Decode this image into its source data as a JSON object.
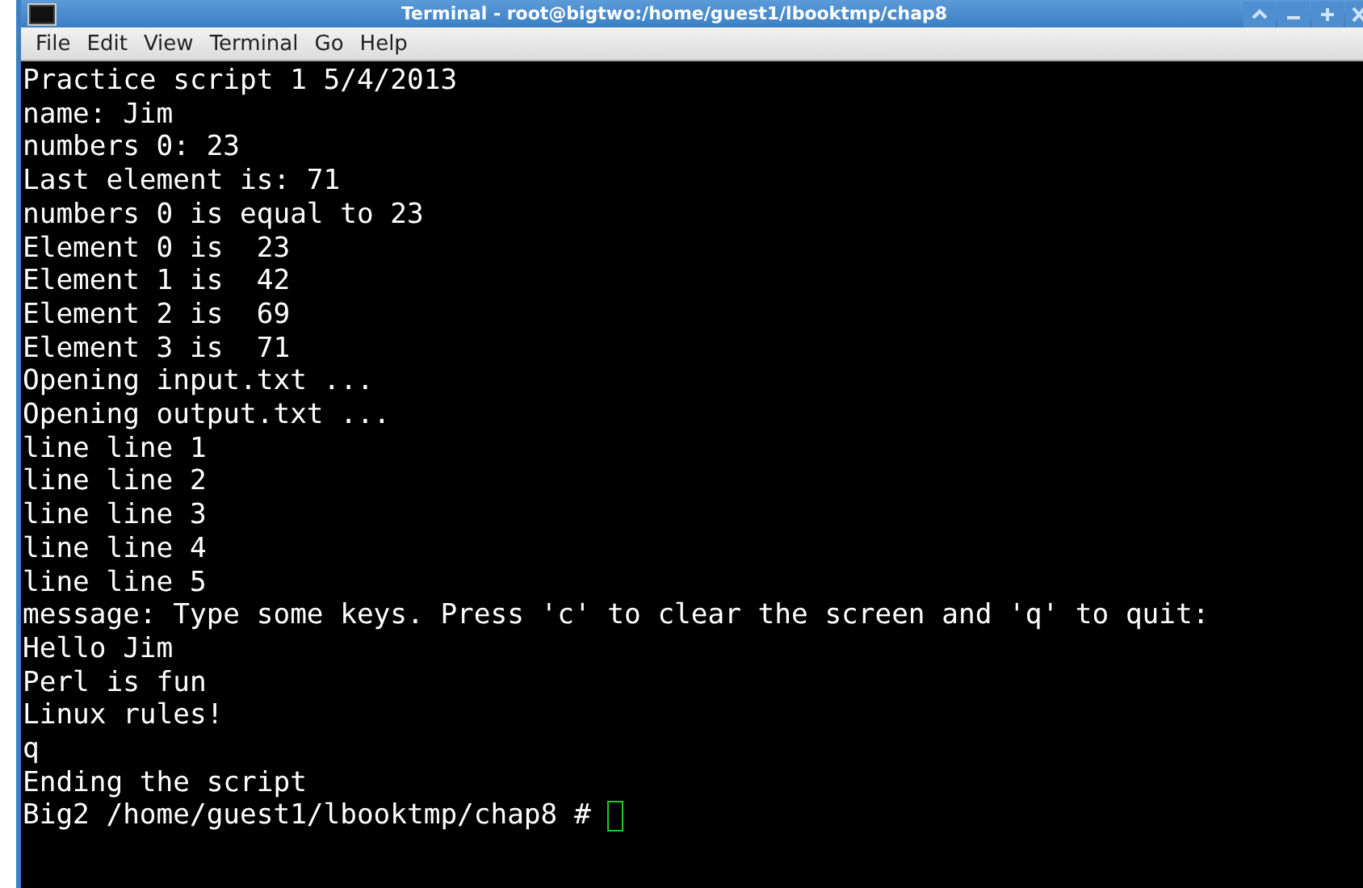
{
  "window": {
    "title": "Terminal - root@bigtwo:/home/guest1/lbooktmp/chap8"
  },
  "menu": [
    "File",
    "Edit",
    "View",
    "Terminal",
    "Go",
    "Help"
  ],
  "terminal": {
    "lines": [
      "Practice script 1 5/4/2013",
      "name: Jim",
      "numbers 0: 23",
      "Last element is: 71",
      "numbers 0 is equal to 23",
      "Element 0 is  23",
      "Element 1 is  42",
      "Element 2 is  69",
      "Element 3 is  71",
      "Opening input.txt ...",
      "Opening output.txt ...",
      "line line 1",
      "line line 2",
      "line line 3",
      "line line 4",
      "line line 5",
      "message: Type some keys. Press 'c' to clear the screen and 'q' to quit:",
      "Hello Jim",
      "Perl is fun",
      "Linux rules!",
      "q",
      "Ending the script"
    ],
    "prompt": "Big2 /home/guest1/lbooktmp/chap8 #"
  }
}
